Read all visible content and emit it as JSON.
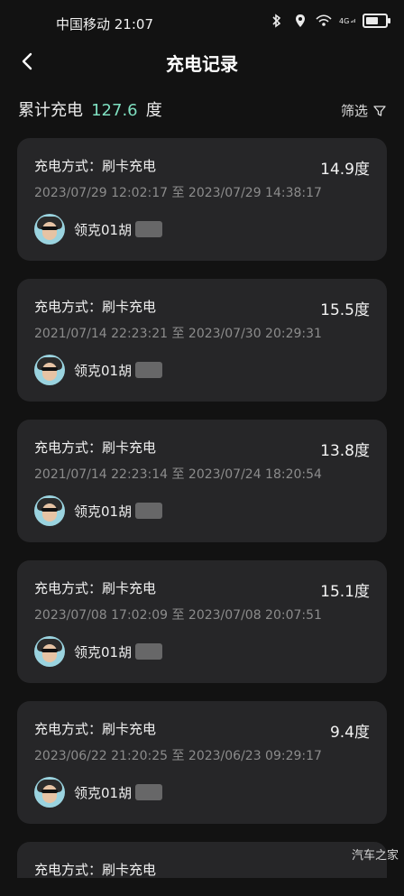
{
  "status_bar": {
    "carrier_time": "中国移动 21:07",
    "network": "4G"
  },
  "header": {
    "title": "充电记录"
  },
  "summary": {
    "label": "累计充电",
    "total": "127.6",
    "unit": "度",
    "filter_label": "筛选"
  },
  "records": [
    {
      "method": "充电方式：刷卡充电",
      "amount": "14.9度",
      "time": "2023/07/29 12:02:17 至 2023/07/29 14:38:17",
      "user": "领克01胡"
    },
    {
      "method": "充电方式：刷卡充电",
      "amount": "15.5度",
      "time": "2021/07/14 22:23:21 至 2023/07/30 20:29:31",
      "user": "领克01胡"
    },
    {
      "method": "充电方式：刷卡充电",
      "amount": "13.8度",
      "time": "2021/07/14 22:23:14 至 2023/07/24 18:20:54",
      "user": "领克01胡"
    },
    {
      "method": "充电方式：刷卡充电",
      "amount": "15.1度",
      "time": "2023/07/08 17:02:09 至 2023/07/08 20:07:51",
      "user": "领克01胡"
    },
    {
      "method": "充电方式：刷卡充电",
      "amount": "9.4度",
      "time": "2023/06/22 21:20:25 至 2023/06/23 09:29:17",
      "user": "领克01胡"
    },
    {
      "method": "充电方式：刷卡充电",
      "amount": "",
      "time": "",
      "user": ""
    }
  ],
  "watermark": "汽车之家",
  "colors": {
    "accent": "#7fe0c1",
    "card": "#262628",
    "bg": "#121212"
  },
  "battery_level": 0.65
}
